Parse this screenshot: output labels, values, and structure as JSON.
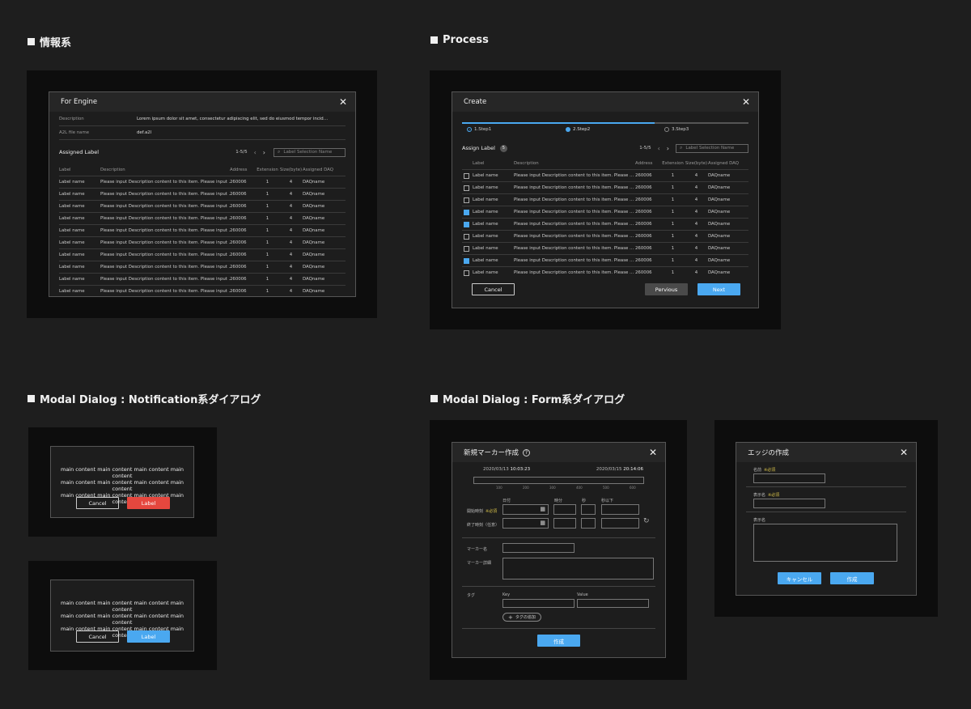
{
  "sections": {
    "info": "情報系",
    "process": "Process",
    "notification": "Modal Dialog : Notification系ダイアログ",
    "form": "Modal Dialog : Form系ダイアログ"
  },
  "engine": {
    "title": "For Engine",
    "desc_label": "Description",
    "desc_value": "Lorem ipsum dolor sit amet, consectetur adipiscing elit, sed do eiusmod tempor incid…",
    "file_label": "A2L file name",
    "file_value": "def.a2l",
    "assigned_label": "Assigned Label",
    "pager": "1-5/5",
    "search_placeholder": "Label Selection Name",
    "columns": [
      "Label",
      "Description",
      "Address",
      "Extension",
      "Size(byte)",
      "Assigned DAQ"
    ],
    "rows": [
      [
        "Label name",
        "Please input Description content to this item. Please input …",
        "260006",
        "1",
        "4",
        "DAQname"
      ],
      [
        "Label name",
        "Please input Description content to this item. Please input …",
        "260006",
        "1",
        "4",
        "DAQname"
      ],
      [
        "Label name",
        "Please input Description content to this item. Please input …",
        "260006",
        "1",
        "4",
        "DAQname"
      ],
      [
        "Label name",
        "Please input Description content to this item. Please input …",
        "260006",
        "1",
        "4",
        "DAQname"
      ],
      [
        "Label name",
        "Please input Description content to this item. Please input …",
        "260006",
        "1",
        "4",
        "DAQname"
      ],
      [
        "Label name",
        "Please input Description content to this item. Please input …",
        "260006",
        "1",
        "4",
        "DAQname"
      ],
      [
        "Label name",
        "Please input Description content to this item. Please input …",
        "260006",
        "1",
        "4",
        "DAQname"
      ],
      [
        "Label name",
        "Please input Description content to this item. Please input …",
        "260006",
        "1",
        "4",
        "DAQname"
      ],
      [
        "Label name",
        "Please input Description content to this item. Please input …",
        "260006",
        "1",
        "4",
        "DAQname"
      ],
      [
        "Label name",
        "Please input Description content to this item. Please input …",
        "260006",
        "1",
        "4",
        "DAQname"
      ]
    ]
  },
  "create": {
    "title": "Create",
    "steps": [
      "1.Step1",
      "2.Step2",
      "3.Step3"
    ],
    "assign_label": "Assign Label",
    "assign_count": "5",
    "pager": "1-5/5",
    "search_placeholder": "Label Selection Name",
    "columns": [
      "Label",
      "Description",
      "Address",
      "Extension",
      "Size(byte)",
      "Assigned DAQ"
    ],
    "rows": [
      {
        "checked": false,
        "cells": [
          "Label name",
          "Please input Description content to this item. Please …",
          "260006",
          "1",
          "4",
          "DAQname"
        ]
      },
      {
        "checked": false,
        "cells": [
          "Label name",
          "Please input Description content to this item. Please …",
          "260006",
          "1",
          "4",
          "DAQname"
        ]
      },
      {
        "checked": false,
        "cells": [
          "Label name",
          "Please input Description content to this item. Please …",
          "260006",
          "1",
          "4",
          "DAQname"
        ]
      },
      {
        "checked": true,
        "cells": [
          "Label name",
          "Please input Description content to this item. Please …",
          "260006",
          "1",
          "4",
          "DAQname"
        ]
      },
      {
        "checked": true,
        "cells": [
          "Label name",
          "Please input Description content to this item. Please …",
          "260006",
          "1",
          "4",
          "DAQname"
        ]
      },
      {
        "checked": false,
        "cells": [
          "Label name",
          "Please input Description content to this item. Please …",
          "260006",
          "1",
          "4",
          "DAQname"
        ]
      },
      {
        "checked": false,
        "cells": [
          "Label name",
          "Please input Description content to this item. Please …",
          "260006",
          "1",
          "4",
          "DAQname"
        ]
      },
      {
        "checked": true,
        "cells": [
          "Label name",
          "Please input Description content to this item. Please …",
          "260006",
          "1",
          "4",
          "DAQname"
        ]
      },
      {
        "checked": false,
        "cells": [
          "Label name",
          "Please input Description content to this item. Please …",
          "260006",
          "1",
          "4",
          "DAQname"
        ]
      }
    ],
    "cancel": "Cancel",
    "previous": "Pervious",
    "next": "Next"
  },
  "notify1": {
    "lines": [
      "main content main content main content main content",
      "main content main content main content main content",
      "main content main content main content main content"
    ],
    "cancel": "Cancel",
    "action": "Label"
  },
  "notify2": {
    "lines": [
      "main content main content main content main content",
      "main content main content main content main content",
      "main content main content main content main content"
    ],
    "cancel": "Cancel",
    "action": "Label"
  },
  "marker": {
    "title": "新規マーカー作成",
    "start_date": "2020/03/13",
    "start_time": "10:03:23",
    "end_date": "2020/03/15",
    "end_time": "20:14:06",
    "ticks": [
      "100",
      "200",
      "300",
      "400",
      "500",
      "600"
    ],
    "col_date": "日付",
    "col_hour": "時分",
    "col_sec": "秒",
    "col_sub": "秒以下",
    "start_label": "開始時刻",
    "required": "※必須",
    "end_label": "終了時刻（任意）",
    "name_label": "マーカー名",
    "detail_label": "マーカー詳細",
    "tag_label": "タグ",
    "key_label": "Key",
    "value_label": "Value",
    "add_tag": "タグの追加",
    "submit": "作成"
  },
  "edge": {
    "title": "エッジの作成",
    "name_label": "名前",
    "required": "※必須",
    "display_label": "表示名",
    "display2_label": "表示名",
    "cancel": "キャンセル",
    "submit": "作成"
  }
}
